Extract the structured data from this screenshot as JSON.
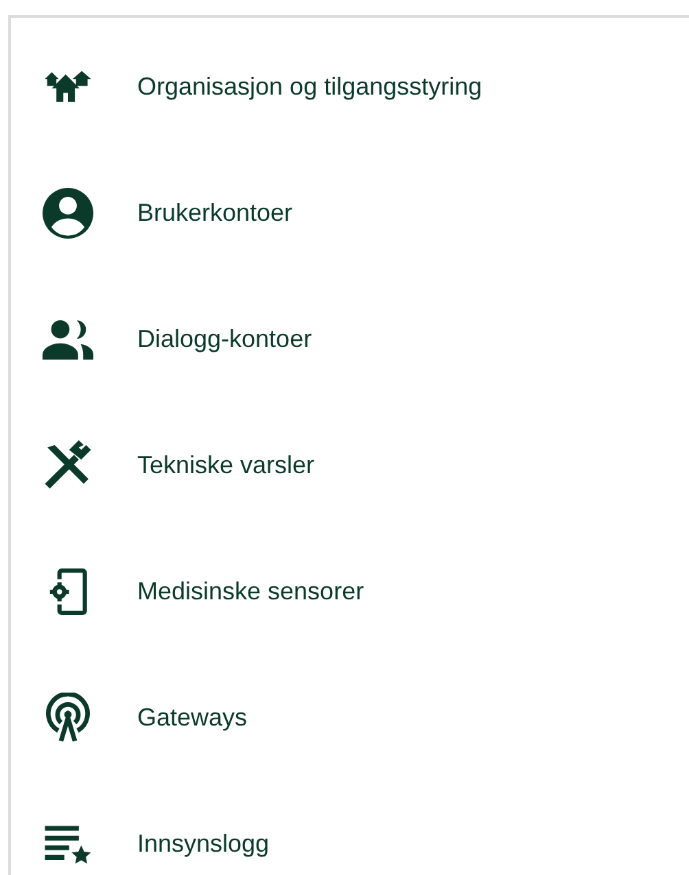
{
  "menu": {
    "items": [
      {
        "kind": "houses",
        "label": "Organisasjon og tilgangsstyring"
      },
      {
        "kind": "user",
        "label": "Brukerkontoer"
      },
      {
        "kind": "group",
        "label": "Dialogg-kontoer"
      },
      {
        "kind": "tools",
        "label": "Tekniske varsler"
      },
      {
        "kind": "device",
        "label": "Medisinske sensorer"
      },
      {
        "kind": "antenna",
        "label": "Gateways"
      },
      {
        "kind": "log",
        "label": "Innsynslogg"
      }
    ]
  }
}
